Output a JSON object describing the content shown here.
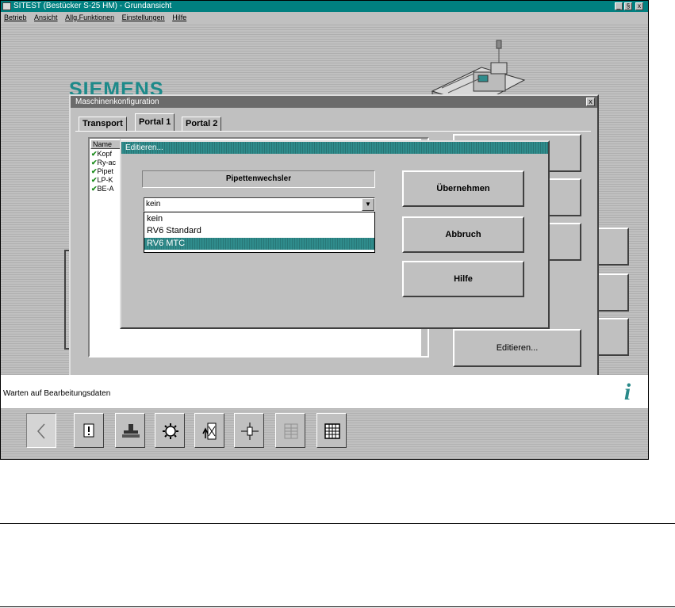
{
  "app": {
    "title": "SITEST (Bestücker S-25 HM) - Grundansicht",
    "window_controls": [
      "_",
      "§",
      "x"
    ]
  },
  "menu": [
    "Betrieb",
    "Ansicht",
    "Allg.Funktionen",
    "Einstellungen",
    "Hilfe"
  ],
  "brand": {
    "logo_text": "SIEMENS",
    "color": "#1d8a8a"
  },
  "config_window": {
    "title": "Maschinenkonfiguration",
    "close": "x",
    "tabs": [
      "Transport",
      "Portal 1",
      "Portal 2"
    ],
    "active_tab": "Portal 1",
    "list_header": "Name",
    "list_items": [
      "Kopf",
      "Ry-ac",
      "Pipet",
      "LP-K",
      "BE-A"
    ],
    "edit_button": "Editieren..."
  },
  "edit_dialog": {
    "title": "Editieren...",
    "group_label": "Pipettenwechsler",
    "combo_value": "kein",
    "options": [
      "kein",
      "RV6 Standard",
      "RV6 MTC"
    ],
    "selected_option": "RV6 MTC",
    "buttons": {
      "apply": "Übernehmen",
      "cancel": "Abbruch",
      "help": "Hilfe"
    },
    "accent_color": "#2f8c8c"
  },
  "status": {
    "text": "Warten auf Bearbeitungsdaten",
    "info_icon": "i"
  },
  "toolbar": {
    "icons": [
      "back-arrow-icon",
      "alert-icon",
      "feeder-icon",
      "gear-icon",
      "pipette-transfer-icon",
      "axis-icon",
      "grid-disabled-icon",
      "grid-icon"
    ]
  }
}
